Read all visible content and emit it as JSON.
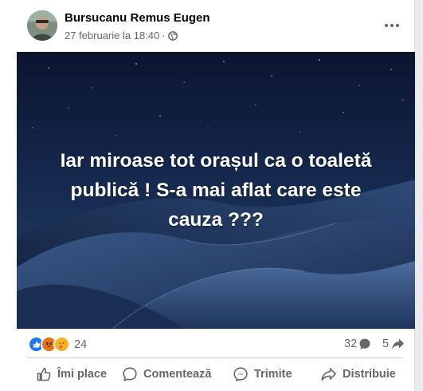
{
  "post": {
    "author": "Bursucanu Remus Eugen",
    "date": "27 februarie la 18:40",
    "separator": "·",
    "privacy_icon": "globe-icon",
    "image_text": "Iar miroase tot orașul ca o toaletă publică ! S-a mai aflat care este cauza ???"
  },
  "stats": {
    "reactions": [
      "like-icon",
      "angry-icon",
      "care-icon"
    ],
    "reaction_count": "24",
    "comment_count": "32",
    "share_count": "5"
  },
  "actions": {
    "like": "Îmi place",
    "comment": "Comentează",
    "send": "Trimite",
    "share": "Distribuie"
  },
  "colors": {
    "like_blue": "#1877f2",
    "angry": "#e9710f",
    "care": "#f7b125",
    "muted_text": "#65676b",
    "image_bg": "#0e1833"
  }
}
